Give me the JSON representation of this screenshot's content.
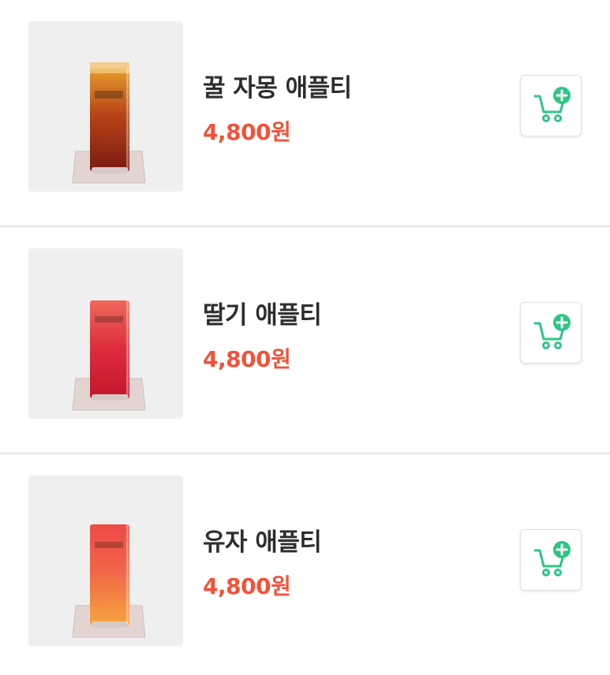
{
  "accent_color": "#2fc587",
  "price_color": "#f0533b",
  "products": [
    {
      "name": "꿀 자몽 애플티",
      "price": "4,800원",
      "icon": "add-to-cart-icon",
      "drink_top": "#e59b2c",
      "drink_bottom": "#7a1a12"
    },
    {
      "name": "딸기 애플티",
      "price": "4,800원",
      "icon": "add-to-cart-icon",
      "drink_top": "#f0675a",
      "drink_bottom": "#c4162c"
    },
    {
      "name": "유자 애플티",
      "price": "4,800원",
      "icon": "add-to-cart-icon",
      "drink_top": "#ee4a45",
      "drink_bottom": "#f7a53d"
    }
  ]
}
